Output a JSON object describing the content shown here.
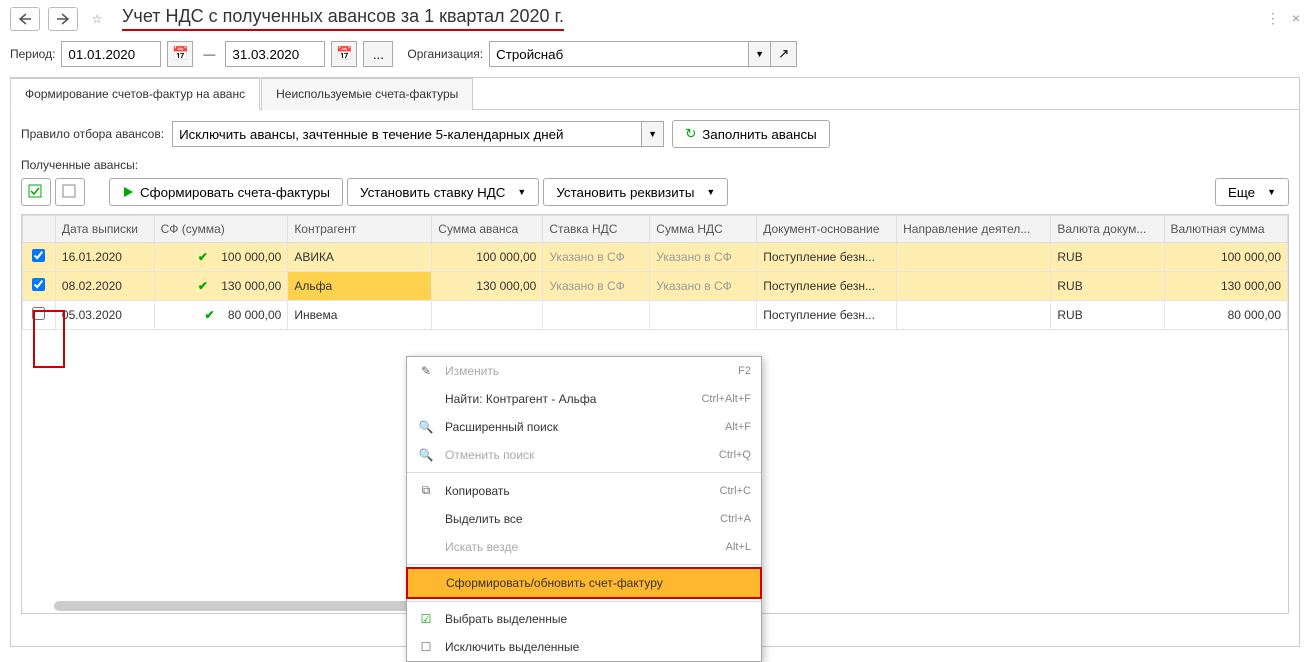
{
  "title": "Учет НДС с полученных авансов за 1 квартал 2020 г.",
  "period": {
    "label": "Период:",
    "from": "01.01.2020",
    "to": "31.03.2020"
  },
  "org": {
    "label": "Организация:",
    "value": "Стройснаб"
  },
  "tabs": {
    "t1": "Формирование счетов-фактур на аванс",
    "t2": "Неиспользуемые счета-фактуры"
  },
  "rule": {
    "label": "Правило отбора авансов:",
    "value": "Исключить авансы, зачтенные в течение 5-календарных дней"
  },
  "fill_btn": "Заполнить авансы",
  "section_label": "Полученные авансы:",
  "toolbar": {
    "form_sf": "Сформировать счета-фактуры",
    "set_vat": "Установить ставку НДС",
    "set_req": "Установить реквизиты",
    "more": "Еще"
  },
  "columns": {
    "date": "Дата выписки",
    "sf": "СФ (сумма)",
    "contr": "Контрагент",
    "sum": "Сумма аванса",
    "vat": "Ставка НДС",
    "vatsum": "Сумма НДС",
    "doc": "Документ-основание",
    "dir": "Направление деятел...",
    "cur": "Валюта докум...",
    "cursum": "Валютная сумма"
  },
  "rows": [
    {
      "checked": true,
      "date": "16.01.2020",
      "sf_check": true,
      "sf_sum": "100 000,00",
      "contr": "АВИКА",
      "sum": "100 000,00",
      "vat": "Указано в СФ",
      "vatsum": "Указано в СФ",
      "doc": "Поступление безн...",
      "dir": "",
      "cur": "RUB",
      "cursum": "100 000,00"
    },
    {
      "checked": true,
      "date": "08.02.2020",
      "sf_check": true,
      "sf_sum": "130 000,00",
      "contr": "Альфа",
      "sum": "130 000,00",
      "vat": "Указано в СФ",
      "vatsum": "Указано в СФ",
      "doc": "Поступление безн...",
      "dir": "",
      "cur": "RUB",
      "cursum": "130 000,00"
    },
    {
      "checked": false,
      "date": "05.03.2020",
      "sf_check": true,
      "sf_sum": "80 000,00",
      "contr": "Инвема",
      "sum": "",
      "vat": "",
      "vatsum": "",
      "doc": "Поступление безн...",
      "dir": "",
      "cur": "RUB",
      "cursum": "80 000,00"
    }
  ],
  "ctx": {
    "edit": "Изменить",
    "edit_k": "F2",
    "find": "Найти: Контрагент - Альфа",
    "find_k": "Ctrl+Alt+F",
    "adv": "Расширенный поиск",
    "adv_k": "Alt+F",
    "cancel": "Отменить поиск",
    "cancel_k": "Ctrl+Q",
    "copy": "Копировать",
    "copy_k": "Ctrl+C",
    "selall": "Выделить все",
    "selall_k": "Ctrl+A",
    "search": "Искать везде",
    "search_k": "Alt+L",
    "form": "Сформировать/обновить счет-фактуру",
    "sel": "Выбрать выделенные",
    "desel": "Исключить выделенные"
  }
}
